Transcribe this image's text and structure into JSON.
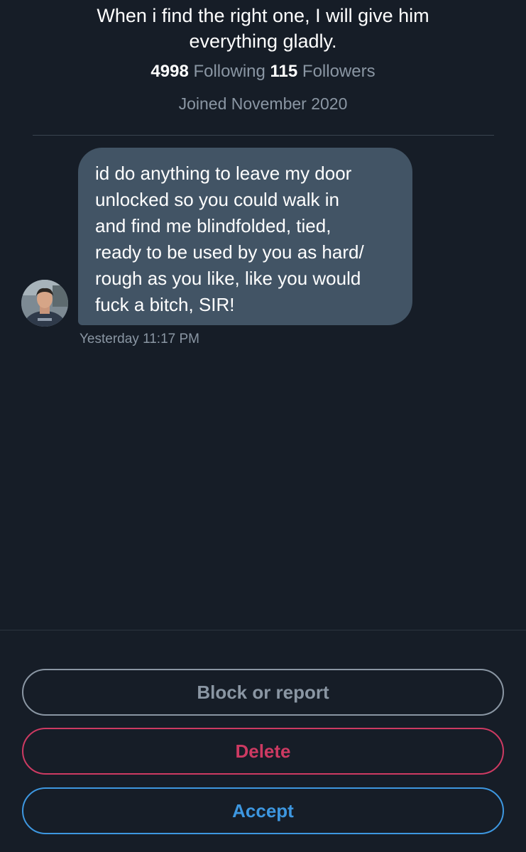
{
  "profile": {
    "bio_lines": [
      "When i find the right one, I will give him",
      "everything gladly."
    ],
    "following_count": "4998",
    "following_label": " Following ",
    "followers_count": "115",
    "followers_label": " Followers",
    "joined": "Joined November 2020"
  },
  "message": {
    "lines": [
      "id do anything to leave my door",
      "unlocked so you could walk in",
      "and find me blindfolded, tied,",
      "ready to be used by you as hard/",
      "rough as you like, like you would",
      "fuck a bitch, SIR!"
    ],
    "timestamp": "Yesterday 11:17 PM",
    "avatar_icon": "user-avatar"
  },
  "actions": {
    "block_label": "Block or report",
    "delete_label": "Delete",
    "accept_label": "Accept"
  },
  "colors": {
    "background": "#161d27",
    "bubble": "#425465",
    "muted_text": "#8a96a3",
    "delete": "#cd3a62",
    "accept": "#3d97e0"
  }
}
